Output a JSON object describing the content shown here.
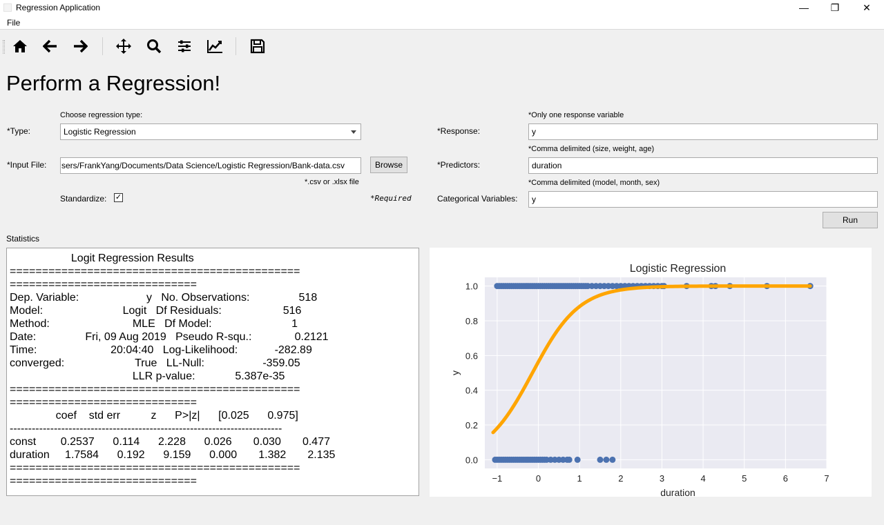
{
  "window": {
    "title": "Regression Application",
    "minimize": "—",
    "maximize": "❐",
    "close": "✕"
  },
  "menu": {
    "file": "File"
  },
  "toolbar": {
    "icons": [
      "home-icon",
      "back-arrow-icon",
      "forward-arrow-icon",
      "pan-icon",
      "zoom-icon",
      "configure-subplots-icon",
      "edit-axes-icon",
      "save-icon"
    ]
  },
  "page": {
    "title": "Perform a Regression!"
  },
  "form": {
    "type_label": "*Type:",
    "type_hint": "Choose regression type:",
    "type_value": "Logistic Regression",
    "input_file_label": "*Input File:",
    "input_file_value": "sers/FrankYang/Documents/Data Science/Logistic Regression/Bank-data.csv",
    "browse_label": "Browse",
    "file_hint": "*.csv or .xlsx file",
    "standardize_label": "Standardize:",
    "standardize_checked": "✓",
    "required_note": "*Required",
    "response_label": "*Response:",
    "response_hint": "*Only one response variable",
    "response_value": "y",
    "predictors_label": "*Predictors:",
    "predictors_hint": "*Comma delimited (size, weight, age)",
    "predictors_value": "duration",
    "categorical_label": "Categorical Variables:",
    "categorical_hint": "*Comma delimited (model, month, sex)",
    "categorical_value": "y",
    "run_label": "Run"
  },
  "statistics": {
    "label": "Statistics",
    "text": "                    Logit Regression Results\n=============================================\n=============================\nDep. Variable:                      y   No. Observations:                518\nModel:                          Logit   Df Residuals:                    516\nMethod:                           MLE   Df Model:                          1\nDate:                Fri, 09 Aug 2019   Pseudo R-squ.:              0.2121\nTime:                        20:04:40   Log-Likelihood:            -282.89\nconverged:                       True   LL-Null:                   -359.05\n                                        LLR p-value:             5.387e-35\n=============================================\n=============================\n               coef    std err          z      P>|z|      [0.025      0.975]\n--------------------------------------------------------------------------\nconst        0.2537      0.114      2.228      0.026       0.030       0.477\nduration     1.7584      0.192      9.159      0.000       1.382       2.135\n=============================================\n============================="
  },
  "chart_data": {
    "type": "scatter",
    "title": "Logistic Regression",
    "xlabel": "duration",
    "ylabel": "y",
    "xlim": [
      -1.3,
      7.0
    ],
    "ylim": [
      -0.05,
      1.05
    ],
    "xticks": [
      -1,
      0,
      1,
      2,
      3,
      4,
      5,
      6,
      7
    ],
    "yticks": [
      0.0,
      0.2,
      0.4,
      0.6,
      0.8,
      1.0
    ],
    "xtick_labels": [
      "−1",
      "0",
      "1",
      "2",
      "3",
      "4",
      "5",
      "6",
      "7"
    ],
    "ytick_labels": [
      "0.0",
      "0.2",
      "0.4",
      "0.6",
      "0.8",
      "1.0"
    ],
    "grid": true,
    "background": "#eaeaf2",
    "point_color": "#4c72b0",
    "curve_color": "#ffa500",
    "series": [
      {
        "kind": "points",
        "points_y1": [
          -1.0,
          -0.95,
          -0.9,
          -0.85,
          -0.8,
          -0.75,
          -0.7,
          -0.65,
          -0.6,
          -0.55,
          -0.5,
          -0.45,
          -0.4,
          -0.35,
          -0.3,
          -0.25,
          -0.2,
          -0.15,
          -0.1,
          -0.05,
          0.0,
          0.05,
          0.1,
          0.15,
          0.2,
          0.25,
          0.3,
          0.35,
          0.4,
          0.45,
          0.5,
          0.55,
          0.6,
          0.65,
          0.7,
          0.75,
          0.8,
          0.85,
          0.9,
          0.95,
          1.0,
          1.05,
          1.1,
          1.15,
          1.2,
          1.3,
          1.4,
          1.5,
          1.6,
          1.7,
          1.8,
          1.9,
          2.0,
          2.1,
          2.2,
          2.3,
          2.4,
          2.5,
          2.6,
          2.7,
          2.8,
          2.9,
          3.0,
          3.05,
          3.6,
          4.2,
          4.3,
          4.65,
          5.55,
          6.6
        ],
        "points_y0": [
          -1.05,
          -1.0,
          -0.95,
          -0.9,
          -0.85,
          -0.8,
          -0.75,
          -0.7,
          -0.65,
          -0.6,
          -0.55,
          -0.5,
          -0.45,
          -0.4,
          -0.35,
          -0.3,
          -0.25,
          -0.2,
          -0.15,
          -0.1,
          -0.05,
          0.0,
          0.05,
          0.1,
          0.15,
          0.2,
          0.3,
          0.4,
          0.5,
          0.6,
          0.7,
          0.75,
          0.95,
          1.5,
          1.65,
          1.8
        ]
      },
      {
        "kind": "logistic_curve",
        "const": 0.2537,
        "coef": 1.7584,
        "x_range": [
          -1.1,
          6.6
        ]
      }
    ]
  }
}
